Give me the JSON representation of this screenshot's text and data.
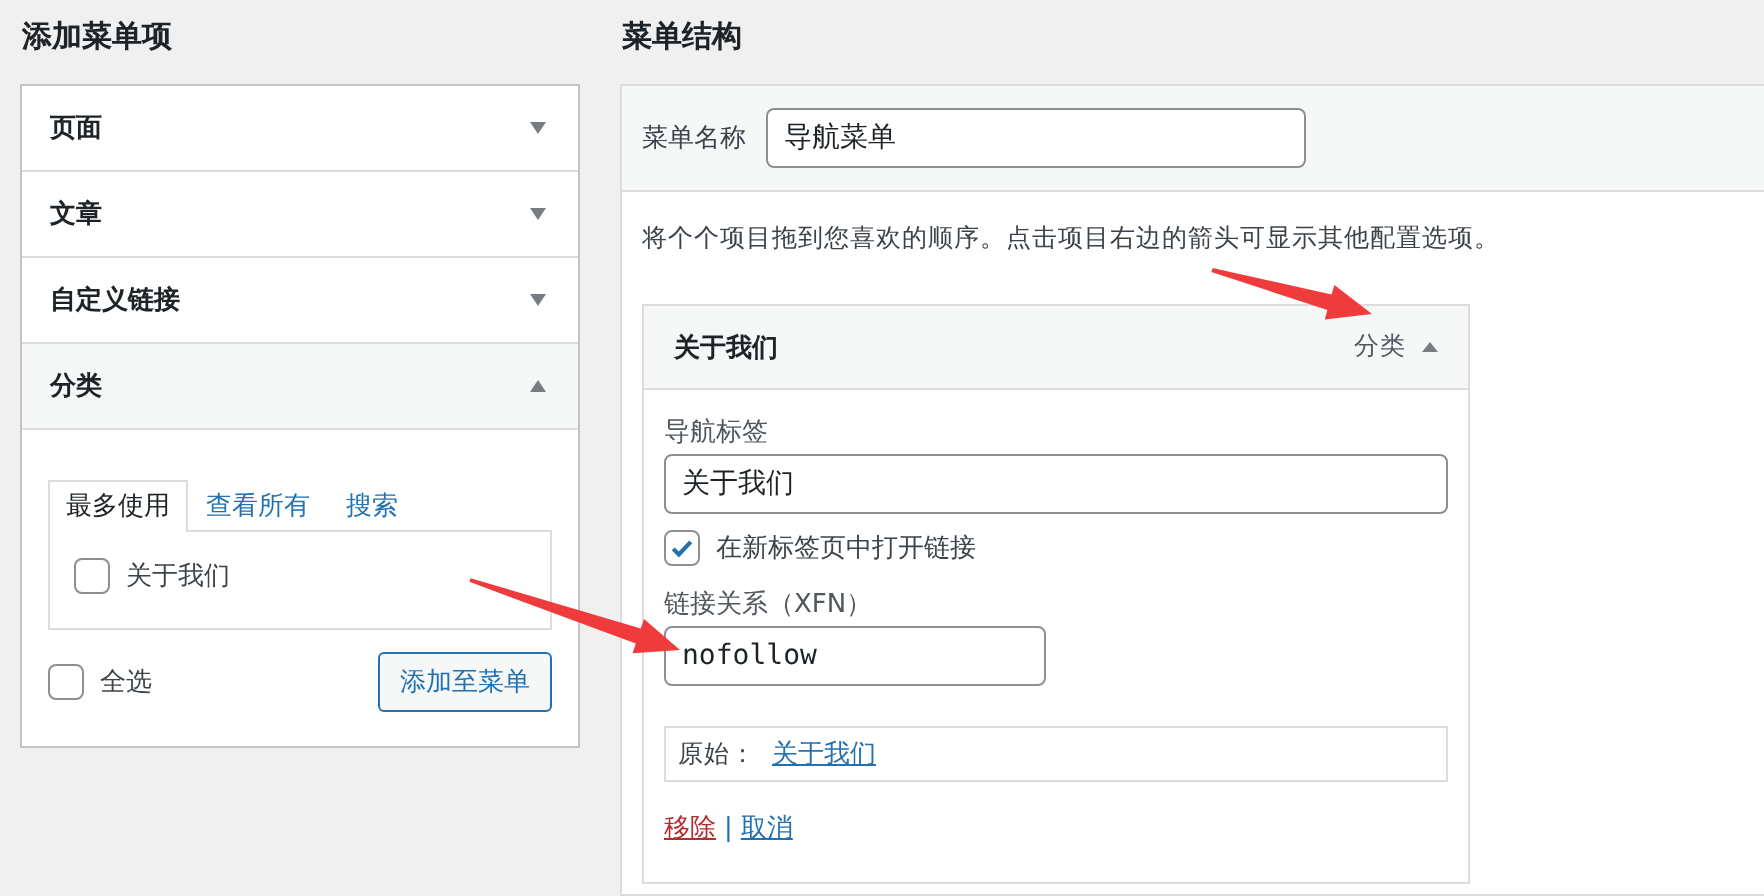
{
  "left": {
    "title": "添加菜单项",
    "sections": [
      {
        "label": "页面",
        "expanded": false
      },
      {
        "label": "文章",
        "expanded": false
      },
      {
        "label": "自定义链接",
        "expanded": false
      },
      {
        "label": "分类",
        "expanded": true,
        "tabs": [
          {
            "label": "最多使用",
            "selected": true
          },
          {
            "label": "查看所有",
            "selected": false
          },
          {
            "label": "搜索",
            "selected": false
          }
        ],
        "items": [
          {
            "label": "关于我们",
            "checked": false
          }
        ],
        "select_all": {
          "label": "全选",
          "checked": false
        },
        "add_button": "添加至菜单"
      }
    ]
  },
  "right": {
    "title": "菜单结构",
    "name_label": "菜单名称",
    "name_value": "导航菜单",
    "instructions": "将个个项目拖到您喜欢的顺序。点击项目右边的箭头可显示其他配置选项。",
    "menu_items": [
      {
        "title": "关于我们",
        "type_label": "分类",
        "expanded": true,
        "nav_label": {
          "label": "导航标签",
          "value": "关于我们"
        },
        "new_tab": {
          "label": "在新标签页中打开链接",
          "checked": true
        },
        "xfn": {
          "label": "链接关系（XFN）",
          "value": "nofollow"
        },
        "original": {
          "label": "原始：",
          "link": "关于我们"
        },
        "remove": "移除",
        "separator": "|",
        "cancel": "取消"
      }
    ]
  }
}
